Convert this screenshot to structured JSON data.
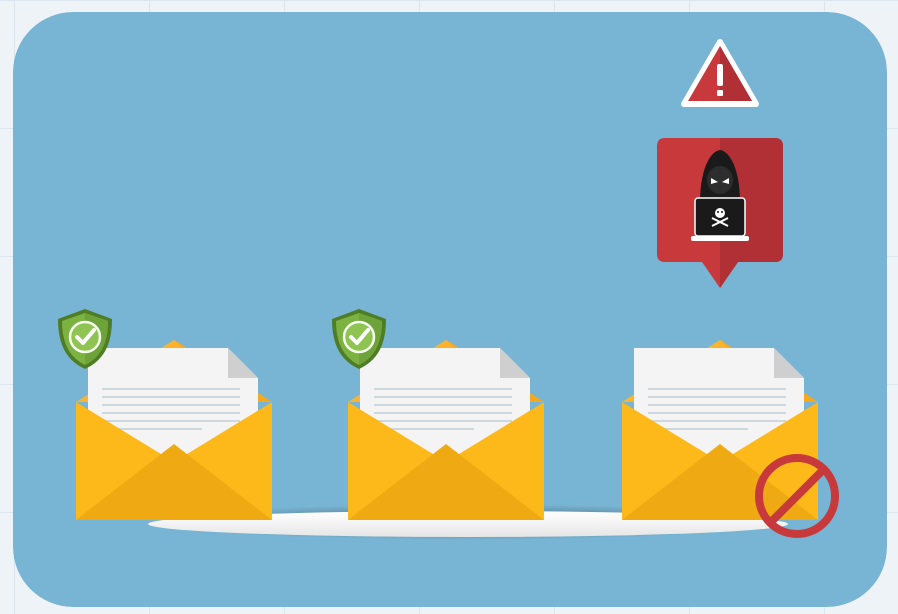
{
  "scene": {
    "emails": [
      {
        "status": "safe",
        "badge": "shield-check"
      },
      {
        "status": "safe",
        "badge": "shield-check"
      },
      {
        "status": "blocked",
        "badge": "prohibited"
      }
    ],
    "alert": {
      "icon": "warning-triangle",
      "threat": "hooded-hacker-with-laptop"
    },
    "colors": {
      "background": "#78b5d4",
      "envelope": "#ffc112",
      "envelope_shadow": "#efa912",
      "shield": "#7bb241",
      "alert": "#c8393c",
      "prohibited": "#c8393c"
    }
  }
}
